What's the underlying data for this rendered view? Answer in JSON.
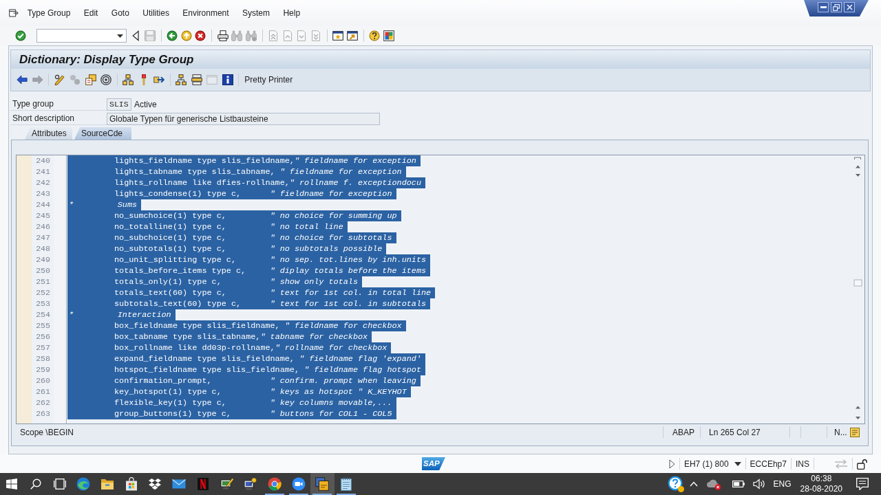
{
  "menu": [
    "Type Group",
    "Edit",
    "Goto",
    "Utilities",
    "Environment",
    "System",
    "Help"
  ],
  "toolbar": [
    [
      {
        "kind": "enter",
        "disabled": false
      },
      {
        "kind": "command_field",
        "disabled": false
      },
      {
        "kind": "collapse",
        "disabled": false
      },
      {
        "kind": "save",
        "disabled": true
      }
    ],
    [
      {
        "kind": "back",
        "disabled": false
      },
      {
        "kind": "exit",
        "disabled": false
      },
      {
        "kind": "cancel",
        "disabled": false
      }
    ],
    [
      {
        "kind": "print",
        "disabled": false
      },
      {
        "kind": "find",
        "disabled": true
      },
      {
        "kind": "find_next",
        "disabled": true
      }
    ],
    [
      {
        "kind": "first_page",
        "disabled": true
      },
      {
        "kind": "previous_page",
        "disabled": true
      },
      {
        "kind": "next_page",
        "disabled": true
      },
      {
        "kind": "last_page",
        "disabled": true
      }
    ],
    [
      {
        "kind": "new_session",
        "disabled": false
      },
      {
        "kind": "shortcut",
        "disabled": false
      }
    ],
    [
      {
        "kind": "help",
        "disabled": false
      },
      {
        "kind": "layout",
        "disabled": false
      }
    ]
  ],
  "title": "Dictionary: Display Type Group",
  "app_toolbar": [
    [
      {
        "kind": "back_arrow",
        "disabled": false
      },
      {
        "kind": "forward_arrow",
        "disabled": true
      }
    ],
    [
      {
        "kind": "display_change",
        "disabled": false
      },
      {
        "kind": "check",
        "disabled": true
      },
      {
        "kind": "activate",
        "disabled": false
      },
      {
        "kind": "where_used",
        "disabled": false
      }
    ],
    [
      {
        "kind": "navigate",
        "disabled": false
      },
      {
        "kind": "breakpoint",
        "disabled": false
      },
      {
        "kind": "move",
        "disabled": false
      }
    ],
    [
      {
        "kind": "hierarchy",
        "disabled": false
      },
      {
        "kind": "stack",
        "disabled": false
      },
      {
        "kind": "frame",
        "disabled": true
      },
      {
        "kind": "info",
        "disabled": false
      }
    ],
    [
      {
        "kind": "text_button",
        "label": "Pretty Printer",
        "disabled": false
      }
    ]
  ],
  "fields": [
    {
      "label": "Type group",
      "value": "SLIS",
      "status": "Active"
    },
    {
      "label": "Short description",
      "value": "Globale Typen für generische Listbausteine"
    }
  ],
  "tabs": [
    {
      "label": "Attributes",
      "selected": false
    },
    {
      "label": "SourceCde",
      "selected": true
    }
  ],
  "editor": {
    "lines": [
      {
        "number": "240",
        "kind": "code",
        "text": "lights_fieldname type slis_fieldname,*\" fieldname for exception*",
        "selected": true
      },
      {
        "number": "241",
        "kind": "code",
        "text": "lights_tabname type slis_tabname, *\" fieldname for exception*",
        "selected": true
      },
      {
        "number": "242",
        "kind": "code",
        "text": "lights_rollname like dfies-rollname,*\" rollname f. exceptiondocu*",
        "selected": true
      },
      {
        "number": "243",
        "kind": "code",
        "text": "lights_condense(1) type c,      *\" fieldname for exception*",
        "selected": true
      },
      {
        "number": "244",
        "kind": "comment",
        "text": "*         Sums",
        "selected": true
      },
      {
        "number": "245",
        "kind": "code",
        "text": "no_sumchoice(1) type c,         *\" no choice for summing up*",
        "selected": true
      },
      {
        "number": "246",
        "kind": "code",
        "text": "no_totalline(1) type c,         *\" no total line*",
        "selected": true
      },
      {
        "number": "247",
        "kind": "code",
        "text": "no_subchoice(1) type c,         *\" no choice for subtotals*",
        "selected": true
      },
      {
        "number": "248",
        "kind": "code",
        "text": "no_subtotals(1) type c,         *\" no subtotals possible*",
        "selected": true
      },
      {
        "number": "249",
        "kind": "code",
        "text": "no_unit_splitting type c,       *\" no sep. tot.lines by inh.units*",
        "selected": true
      },
      {
        "number": "250",
        "kind": "code",
        "text": "totals_before_items type c,     *\" diplay totals before the items*",
        "selected": true
      },
      {
        "number": "251",
        "kind": "code",
        "text": "totals_only(1) type c,          *\" show only totals*",
        "selected": true
      },
      {
        "number": "252",
        "kind": "code",
        "text": "totals_text(60) type c,         *\" text for 1st col. in total line*",
        "selected": true
      },
      {
        "number": "253",
        "kind": "code",
        "text": "subtotals_text(60) type c,      *\" text for 1st col. in subtotals*",
        "selected": true
      },
      {
        "number": "254",
        "kind": "comment",
        "text": "*         Interaction",
        "selected": true
      },
      {
        "number": "255",
        "kind": "code",
        "text": "box_fieldname type slis_fieldname, *\" fieldname for checkbox*",
        "selected": true
      },
      {
        "number": "256",
        "kind": "code",
        "text": "box_tabname type slis_tabname,*\" tabname for checkbox*",
        "selected": true
      },
      {
        "number": "257",
        "kind": "code",
        "text": "box_rollname like dd03p-rollname,*\" rollname for checkbox*",
        "selected": true
      },
      {
        "number": "258",
        "kind": "code",
        "text": "expand_fieldname type slis_fieldname, *\" fieldname flag 'expand'*",
        "selected": true
      },
      {
        "number": "259",
        "kind": "code",
        "text": "hotspot_fieldname type slis_fieldname, *\" fieldname flag hotspot*",
        "selected": true
      },
      {
        "number": "260",
        "kind": "code",
        "text": "confirmation_prompt,            *\" confirm. prompt when leaving*",
        "selected": true
      },
      {
        "number": "261",
        "kind": "code",
        "text": "key_hotspot(1) type c,          *\" keys as hotspot \" K_KEYHOT*",
        "selected": true
      },
      {
        "number": "262",
        "kind": "code",
        "text": "flexible_key(1) type c,         *\" key columns movable,...*",
        "selected": true
      },
      {
        "number": "263",
        "kind": "code",
        "text": "group_buttons(1) type c,        *\" buttons for COL1 - COL5*",
        "selected": true
      }
    ],
    "status": {
      "scope": "Scope \\BEGIN",
      "language": "ABAP",
      "position": "Ln 265 Col 27",
      "extra": "N..."
    }
  },
  "status_bar": {
    "logo": "SAP",
    "system": "EH7 (1) 800",
    "server": "ECCEhp7",
    "mode": "INS"
  },
  "taskbar": {
    "items": [
      {
        "kind": "start",
        "running": false,
        "selected": false
      },
      {
        "kind": "search",
        "running": false,
        "selected": false
      },
      {
        "kind": "task_view",
        "running": false,
        "selected": false
      },
      {
        "kind": "edge",
        "running": false,
        "selected": false
      },
      {
        "kind": "explorer",
        "running": false,
        "selected": false
      },
      {
        "kind": "store",
        "running": false,
        "selected": false
      },
      {
        "kind": "dropbox",
        "running": false,
        "selected": false
      },
      {
        "kind": "mail",
        "running": false,
        "selected": false
      },
      {
        "kind": "netflix",
        "running": false,
        "selected": false
      },
      {
        "kind": "sap_tool",
        "running": false,
        "selected": false
      },
      {
        "kind": "sap_tool_key",
        "running": false,
        "selected": false
      },
      {
        "kind": "chrome",
        "running": true,
        "selected": false
      },
      {
        "kind": "zoom",
        "running": true,
        "selected": false
      },
      {
        "kind": "sap_logon",
        "running": true,
        "selected": true
      },
      {
        "kind": "notepad",
        "running": true,
        "selected": false
      }
    ],
    "language": "ENG",
    "time": "06:38",
    "date": "28-08-2020"
  }
}
